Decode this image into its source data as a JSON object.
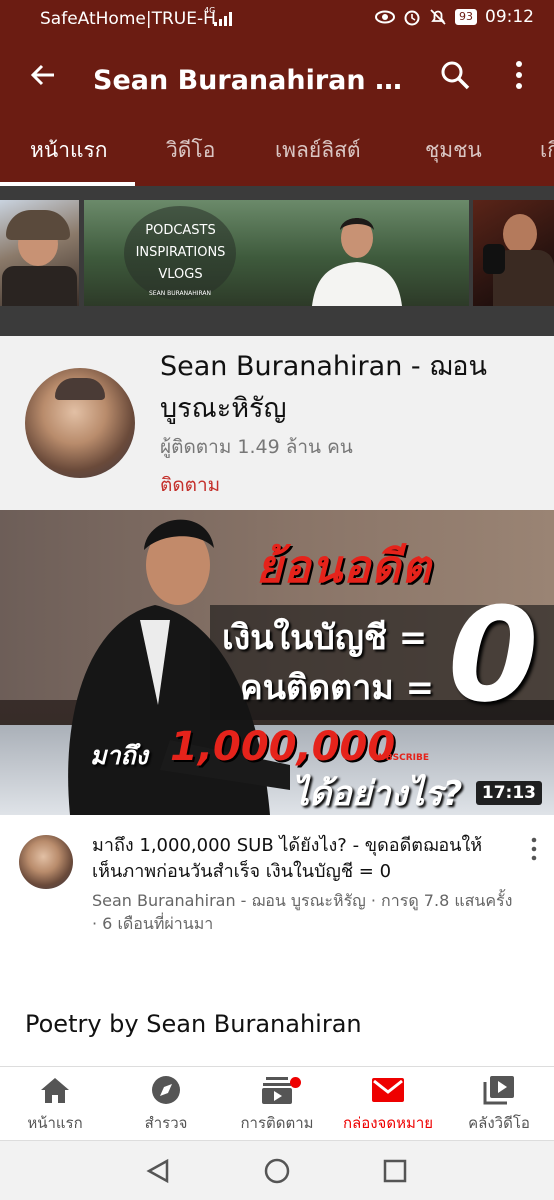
{
  "status_bar": {
    "carrier": "SafeAtHome|TRUE-H",
    "network": "4G",
    "battery": "93",
    "time": "09:12"
  },
  "app_bar": {
    "title": "Sean Buranahiran - ฌอนบูรณะหิรัญ"
  },
  "tabs": [
    {
      "label": "หน้าแรก"
    },
    {
      "label": "วิดีโอ"
    },
    {
      "label": "เพลย์ลิสต์"
    },
    {
      "label": "ชุมชน"
    },
    {
      "label": "เกี่ยวกับ"
    }
  ],
  "banner": {
    "lines": [
      "PODCASTS",
      "INSPIRATIONS",
      "VLOGS"
    ],
    "byline": "SEAN BURANAHIRAN"
  },
  "channel": {
    "name": "Sean Buranahiran - ฌอน บูรณะหิรัญ",
    "subscribers": "ผู้ติดตาม 1.49 ล้าน คน",
    "subscribe_label": "ติดตาม"
  },
  "thumbnail": {
    "headline": "ย้อนอดีต",
    "line1": "เงินในบัญชี =",
    "line2": "คนติดตาม =",
    "zero": "0",
    "reach": "มาถึง",
    "million": "1,000,000",
    "subscribe_tag": "SUBSCRIBE",
    "how": "ได้อย่างไร?",
    "duration": "17:13"
  },
  "video": {
    "title": "มาถึง 1,000,000 SUB ได้ยังไง? - ขุดอดีตฌอนให้เห็นภาพก่อนวันสำเร็จ เงินในบัญชี = 0",
    "meta": "Sean Buranahiran - ฌอน บูรณะหิรัญ · การดู 7.8 แสนครั้ง · 6 เดือนที่ผ่านมา"
  },
  "section": {
    "title": "Poetry by Sean Buranahiran"
  },
  "bottom_nav": [
    {
      "label": "หน้าแรก",
      "icon": "home-icon"
    },
    {
      "label": "สำรวจ",
      "icon": "explore-icon"
    },
    {
      "label": "การติดตาม",
      "icon": "subscriptions-icon"
    },
    {
      "label": "กล่องจดหมาย",
      "icon": "inbox-icon"
    },
    {
      "label": "คลังวิดีโอ",
      "icon": "library-icon"
    }
  ],
  "colors": {
    "brand": "#6b1c12",
    "accent": "#e5231b",
    "active_nav": "#ee0000"
  }
}
